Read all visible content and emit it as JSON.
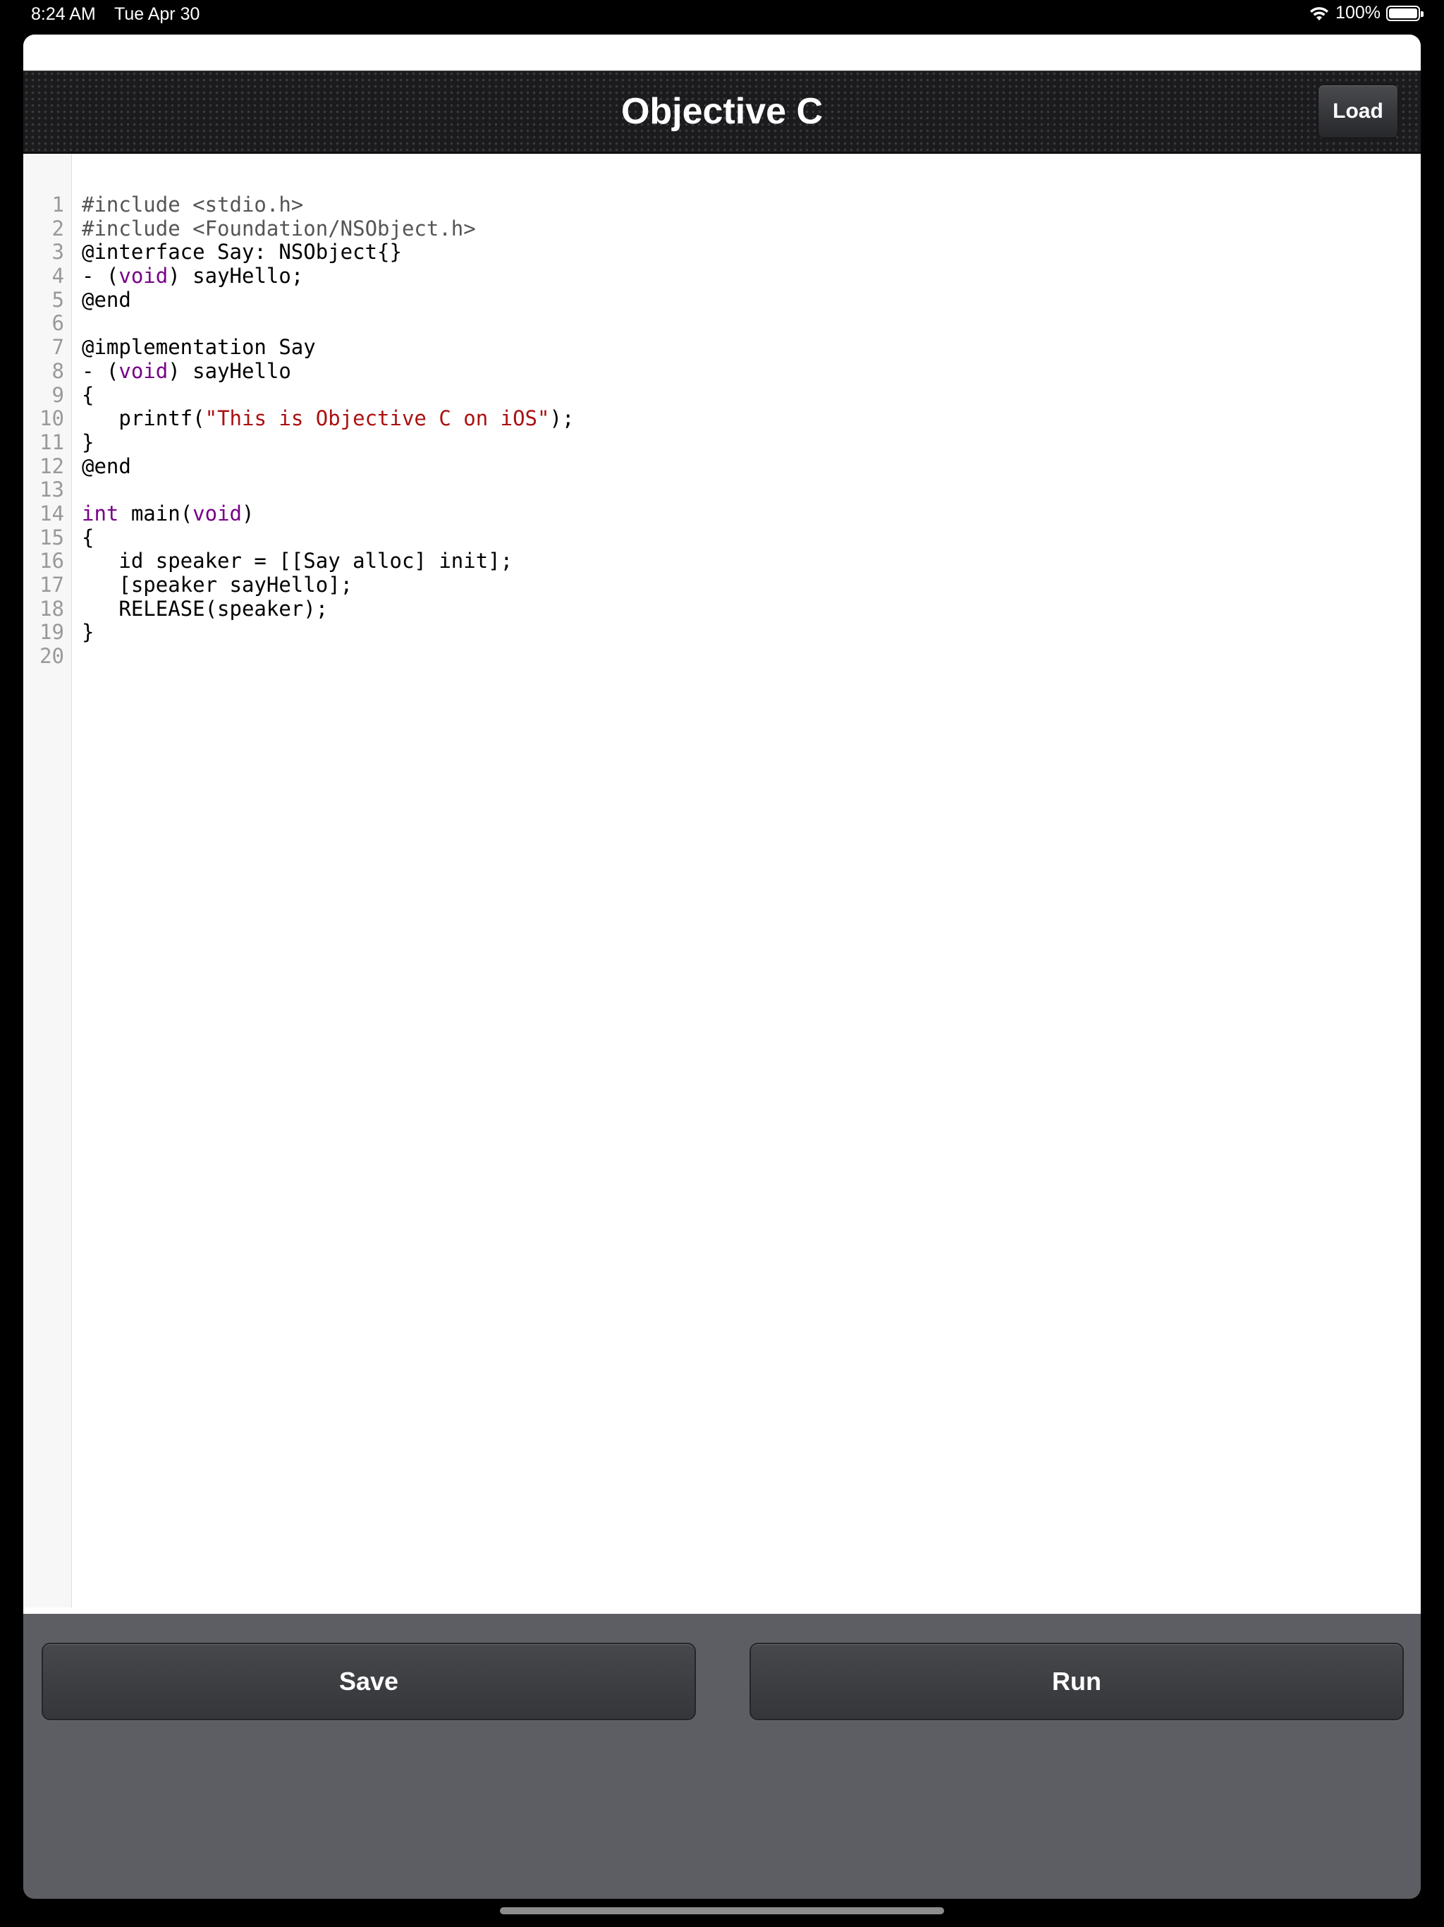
{
  "status_bar": {
    "time": "8:24 AM",
    "date": "Tue Apr 30",
    "battery": "100%",
    "battery_level": 1.0
  },
  "nav": {
    "title": "Objective C",
    "load_label": "Load"
  },
  "editor": {
    "lines": [
      {
        "n": "1",
        "tokens": [
          {
            "t": "#include <stdio.h>",
            "c": "meta"
          }
        ]
      },
      {
        "n": "2",
        "tokens": [
          {
            "t": "#include <Foundation/NSObject.h>",
            "c": "meta"
          }
        ]
      },
      {
        "n": "3",
        "tokens": [
          {
            "t": "@interface Say: NSObject{}",
            "c": ""
          }
        ]
      },
      {
        "n": "4",
        "tokens": [
          {
            "t": "- (",
            "c": ""
          },
          {
            "t": "void",
            "c": "kw"
          },
          {
            "t": ") sayHello;",
            "c": ""
          }
        ]
      },
      {
        "n": "5",
        "tokens": [
          {
            "t": "@end",
            "c": ""
          }
        ]
      },
      {
        "n": "6",
        "tokens": []
      },
      {
        "n": "7",
        "tokens": [
          {
            "t": "@implementation Say",
            "c": ""
          }
        ]
      },
      {
        "n": "8",
        "tokens": [
          {
            "t": "- (",
            "c": ""
          },
          {
            "t": "void",
            "c": "kw"
          },
          {
            "t": ") sayHello",
            "c": ""
          }
        ]
      },
      {
        "n": "9",
        "tokens": [
          {
            "t": "{",
            "c": ""
          }
        ]
      },
      {
        "n": "10",
        "tokens": [
          {
            "t": "   printf(",
            "c": ""
          },
          {
            "t": "\"This is Objective C on iOS\"",
            "c": "str"
          },
          {
            "t": ");",
            "c": ""
          }
        ]
      },
      {
        "n": "11",
        "tokens": [
          {
            "t": "}",
            "c": ""
          }
        ]
      },
      {
        "n": "12",
        "tokens": [
          {
            "t": "@end",
            "c": ""
          }
        ]
      },
      {
        "n": "13",
        "tokens": []
      },
      {
        "n": "14",
        "tokens": [
          {
            "t": "int",
            "c": "kw"
          },
          {
            "t": " main(",
            "c": ""
          },
          {
            "t": "void",
            "c": "kw"
          },
          {
            "t": ")",
            "c": ""
          }
        ]
      },
      {
        "n": "15",
        "tokens": [
          {
            "t": "{",
            "c": ""
          }
        ]
      },
      {
        "n": "16",
        "tokens": [
          {
            "t": "   id speaker = [[Say alloc] init];",
            "c": ""
          }
        ]
      },
      {
        "n": "17",
        "tokens": [
          {
            "t": "   [speaker sayHello];",
            "c": ""
          }
        ]
      },
      {
        "n": "18",
        "tokens": [
          {
            "t": "   RELEASE(speaker);",
            "c": ""
          }
        ]
      },
      {
        "n": "19",
        "tokens": [
          {
            "t": "}",
            "c": ""
          }
        ]
      },
      {
        "n": "20",
        "tokens": []
      }
    ]
  },
  "actions": {
    "save_label": "Save",
    "run_label": "Run"
  },
  "colors": {
    "keyword": "#770088",
    "string": "#aa1111",
    "meta": "#555555",
    "panel": "#5c5e63"
  },
  "icons": [
    "wifi-icon",
    "battery-icon"
  ]
}
